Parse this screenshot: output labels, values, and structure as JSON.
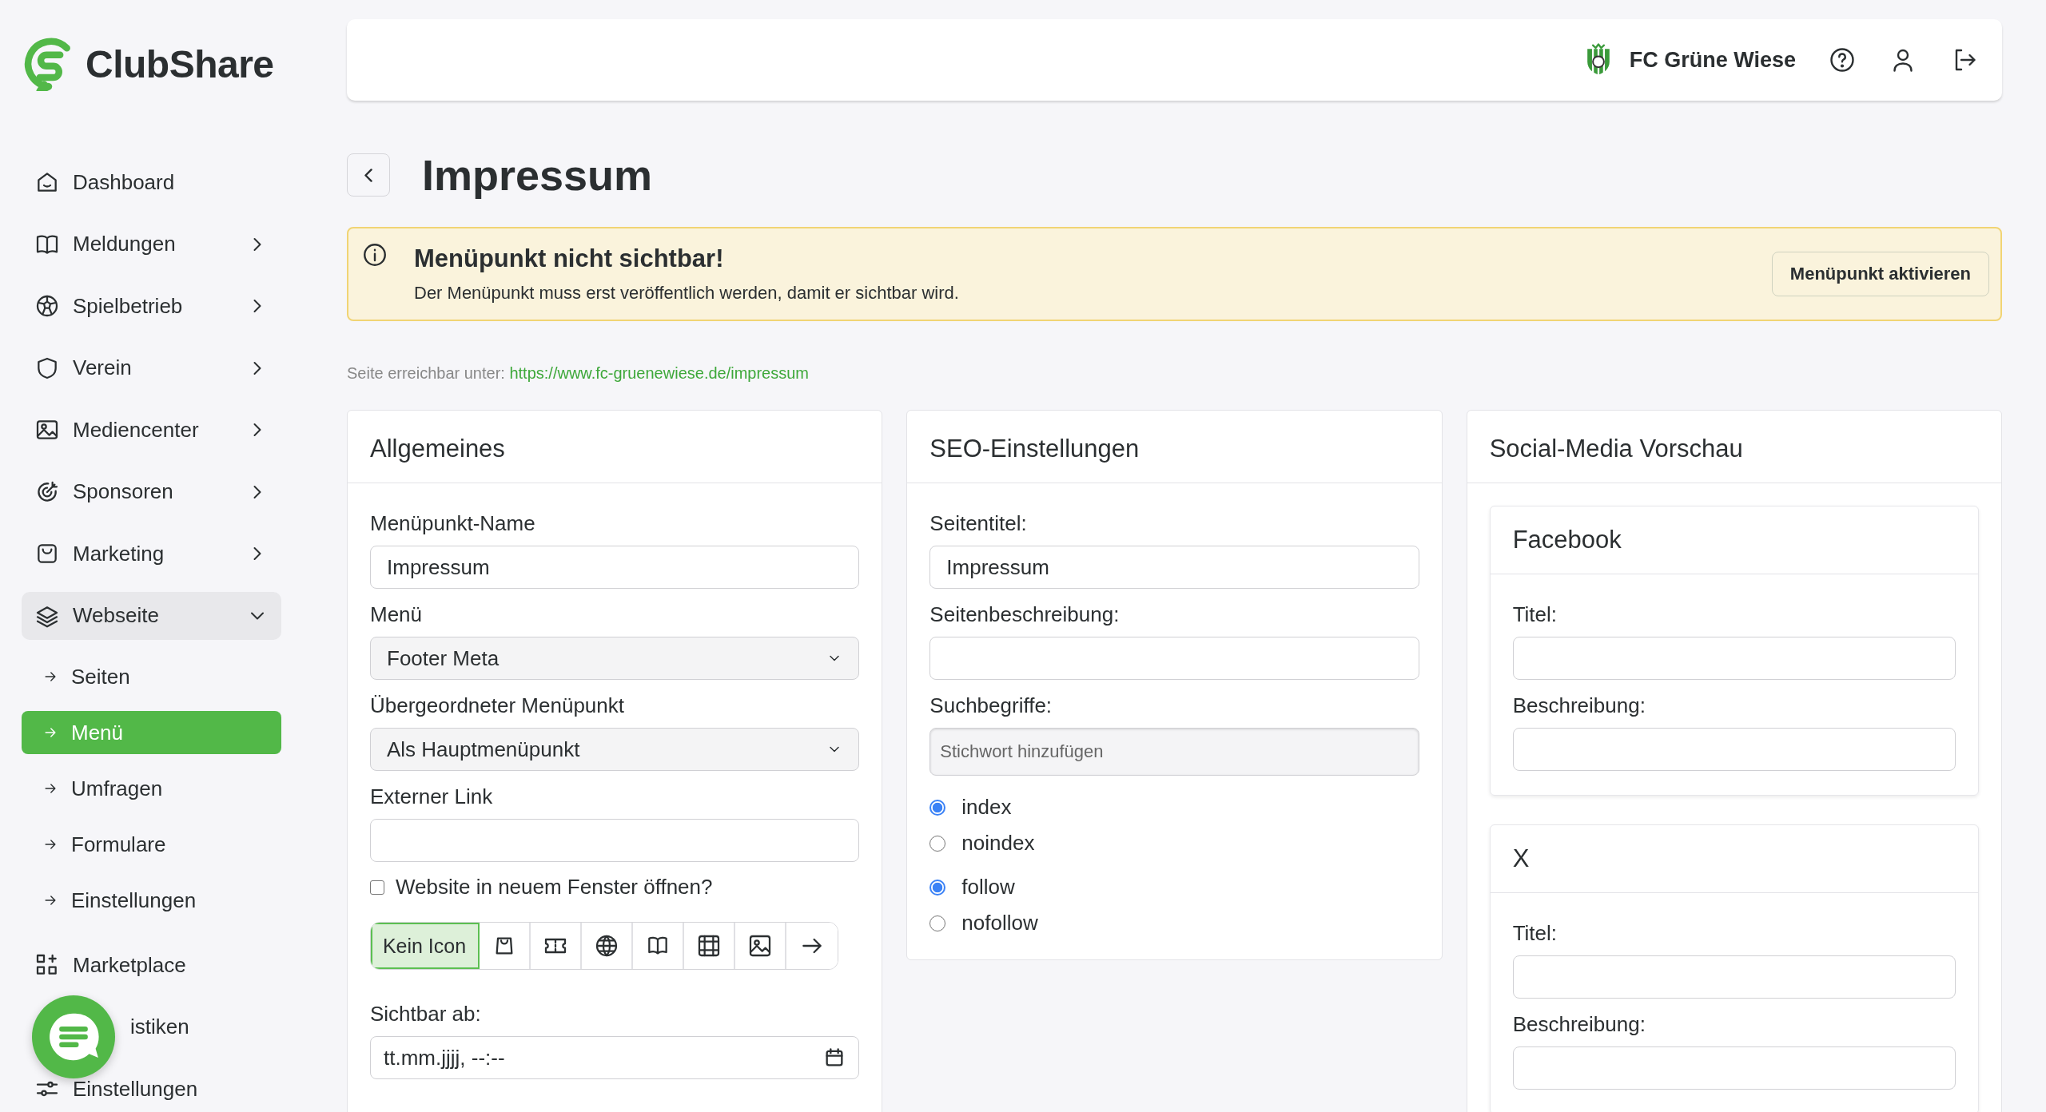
{
  "brand": {
    "name": "ClubShare"
  },
  "sidebar": {
    "items": [
      {
        "label": "Dashboard",
        "has_submenu": false,
        "selected": false
      },
      {
        "label": "Meldungen",
        "has_submenu": true,
        "expanded": false,
        "selected": false
      },
      {
        "label": "Spielbetrieb",
        "has_submenu": true,
        "expanded": false,
        "selected": false
      },
      {
        "label": "Verein",
        "has_submenu": true,
        "expanded": false,
        "selected": false
      },
      {
        "label": "Mediencenter",
        "has_submenu": true,
        "expanded": false,
        "selected": false
      },
      {
        "label": "Sponsoren",
        "has_submenu": true,
        "expanded": false,
        "selected": false
      },
      {
        "label": "Marketing",
        "has_submenu": true,
        "expanded": false,
        "selected": false
      },
      {
        "label": "Webseite",
        "has_submenu": true,
        "expanded": true,
        "selected": true,
        "children": [
          {
            "label": "Seiten",
            "selected": false
          },
          {
            "label": "Menü",
            "selected": true
          },
          {
            "label": "Umfragen",
            "selected": false
          },
          {
            "label": "Formulare",
            "selected": false
          },
          {
            "label": "Einstellungen",
            "selected": false
          }
        ]
      },
      {
        "label": "Marketplace",
        "has_submenu": false,
        "selected": false
      },
      {
        "label": "istiken",
        "has_submenu": false,
        "selected": false
      },
      {
        "label": "Einstellungen",
        "has_submenu": false,
        "selected": false
      }
    ]
  },
  "header": {
    "club_name": "FC Grüne Wiese"
  },
  "page": {
    "title": "Impressum"
  },
  "alert": {
    "title": "Menüpunkt nicht sichtbar!",
    "message": "Der Menüpunkt muss erst veröffentlich werden, damit er sichtbar wird.",
    "button": "Menüpunkt aktivieren"
  },
  "url_line": {
    "label": "Seite erreichbar unter:",
    "link": "https://www.fc-gruenewiese.de/impressum"
  },
  "general": {
    "title": "Allgemeines",
    "name_label": "Menüpunkt-Name",
    "name_value": "Impressum",
    "menu_label": "Menü",
    "menu_value": "Footer Meta",
    "parent_label": "Übergeordneter Menüpunkt",
    "parent_value": "Als Hauptmenüpunkt",
    "link_label": "Externer Link",
    "new_window": {
      "label": "Website in neuem Fenster öffnen?",
      "checked": false
    },
    "icons": [
      {
        "kind": "text",
        "label": "Kein Icon",
        "selected": true
      },
      {
        "kind": "bag",
        "selected": false
      },
      {
        "kind": "ticket",
        "selected": false
      },
      {
        "kind": "globe",
        "selected": false
      },
      {
        "kind": "book",
        "selected": false
      },
      {
        "kind": "film",
        "selected": false
      },
      {
        "kind": "image",
        "selected": false
      },
      {
        "kind": "arrow",
        "selected": false
      }
    ],
    "visible_label": "Sichtbar ab:",
    "visible_placeholder": "tt.mm.jjjj, --:--"
  },
  "seo": {
    "title": "SEO-Einstellungen",
    "title_label": "Seitentitel:",
    "title_value": "Impressum",
    "desc_label": "Seitenbeschreibung:",
    "keywords_label": "Suchbegriffe:",
    "keywords_placeholder": "Stichwort hinzufügen",
    "index_options": [
      {
        "label": "index",
        "selected": true
      },
      {
        "label": "noindex",
        "selected": false
      }
    ],
    "follow_options": [
      {
        "label": "follow",
        "selected": true
      },
      {
        "label": "nofollow",
        "selected": false
      }
    ]
  },
  "social": {
    "title": "Social-Media Vorschau",
    "cards": [
      {
        "title": "Facebook",
        "title_label": "Titel:",
        "desc_label": "Beschreibung:"
      },
      {
        "title": "X",
        "title_label": "Titel:",
        "desc_label": "Beschreibung:"
      }
    ]
  }
}
